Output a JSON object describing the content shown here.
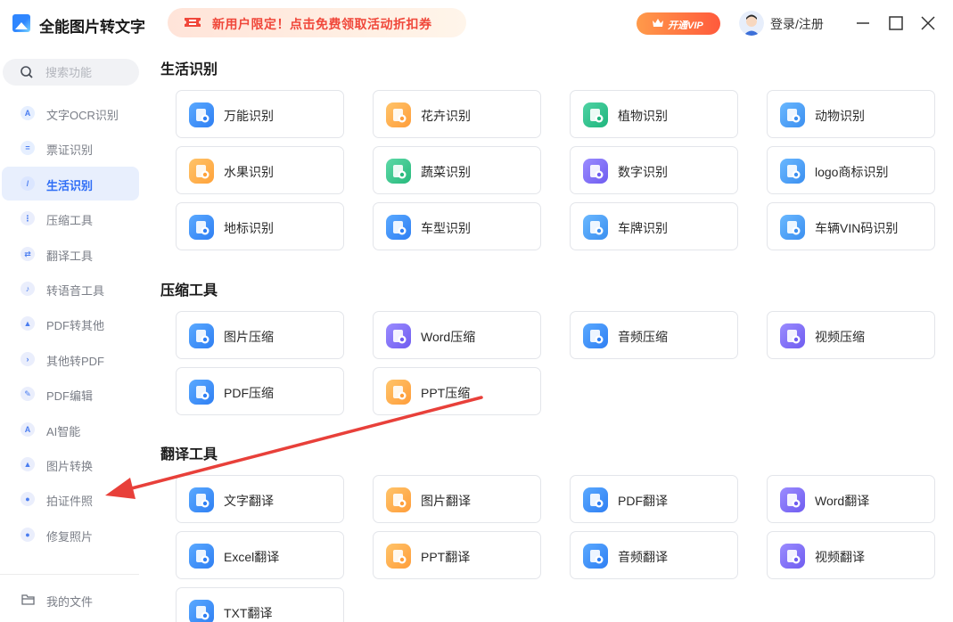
{
  "app": {
    "title": "全能图片转文字"
  },
  "promo": {
    "text": "新用户限定！点击免费领取活动折扣券"
  },
  "header": {
    "vip_label": "开通VIP",
    "login_label": "登录/注册"
  },
  "colors": {
    "accent": "#2f6ef6",
    "promo_text": "#f0473a",
    "vip_start": "#ff9a4a",
    "vip_end": "#ff5a3c",
    "arrow": "#e8403a"
  },
  "sidebar": {
    "search_placeholder": "搜索功能",
    "items": [
      {
        "label": "文字OCR识别",
        "icon": "ocr-icon",
        "active": false
      },
      {
        "label": "票证识别",
        "icon": "ticket-icon",
        "active": false
      },
      {
        "label": "生活识别",
        "icon": "life-icon",
        "active": true
      },
      {
        "label": "压缩工具",
        "icon": "compress-icon",
        "active": false
      },
      {
        "label": "翻译工具",
        "icon": "translate-icon",
        "active": false
      },
      {
        "label": "转语音工具",
        "icon": "voice-icon",
        "active": false
      },
      {
        "label": "PDF转其他",
        "icon": "pdf-to-icon",
        "active": false
      },
      {
        "label": "其他转PDF",
        "icon": "to-pdf-icon",
        "active": false
      },
      {
        "label": "PDF编辑",
        "icon": "pdf-edit-icon",
        "active": false
      },
      {
        "label": "AI智能",
        "icon": "ai-icon",
        "active": false
      },
      {
        "label": "图片转换",
        "icon": "image-convert-icon",
        "active": false
      },
      {
        "label": "拍证件照",
        "icon": "id-photo-icon",
        "active": false
      },
      {
        "label": "修复照片",
        "icon": "photo-repair-icon",
        "active": false
      }
    ],
    "my_files_label": "我的文件"
  },
  "sections": [
    {
      "title": "生活识别",
      "items": [
        {
          "label": "万能识别",
          "icon": "universal-recognize-icon"
        },
        {
          "label": "花卉识别",
          "icon": "flower-recognize-icon"
        },
        {
          "label": "植物识别",
          "icon": "plant-recognize-icon"
        },
        {
          "label": "动物识别",
          "icon": "animal-recognize-icon"
        },
        {
          "label": "水果识别",
          "icon": "fruit-recognize-icon"
        },
        {
          "label": "蔬菜识别",
          "icon": "vegetable-recognize-icon"
        },
        {
          "label": "数字识别",
          "icon": "number-recognize-icon"
        },
        {
          "label": "logo商标识别",
          "icon": "logo-recognize-icon"
        },
        {
          "label": "地标识别",
          "icon": "landmark-recognize-icon"
        },
        {
          "label": "车型识别",
          "icon": "car-model-recognize-icon"
        },
        {
          "label": "车牌识别",
          "icon": "license-plate-recognize-icon"
        },
        {
          "label": "车辆VIN码识别",
          "icon": "vin-recognize-icon"
        }
      ]
    },
    {
      "title": "压缩工具",
      "items": [
        {
          "label": "图片压缩",
          "icon": "image-compress-icon"
        },
        {
          "label": "Word压缩",
          "icon": "word-compress-icon"
        },
        {
          "label": "音频压缩",
          "icon": "audio-compress-icon"
        },
        {
          "label": "视频压缩",
          "icon": "video-compress-icon"
        },
        {
          "label": "PDF压缩",
          "icon": "pdf-compress-icon"
        },
        {
          "label": "PPT压缩",
          "icon": "ppt-compress-icon"
        }
      ]
    },
    {
      "title": "翻译工具",
      "items": [
        {
          "label": "文字翻译",
          "icon": "text-translate-icon"
        },
        {
          "label": "图片翻译",
          "icon": "image-translate-icon"
        },
        {
          "label": "PDF翻译",
          "icon": "pdf-translate-icon"
        },
        {
          "label": "Word翻译",
          "icon": "word-translate-icon"
        },
        {
          "label": "Excel翻译",
          "icon": "excel-translate-icon"
        },
        {
          "label": "PPT翻译",
          "icon": "ppt-translate-icon"
        },
        {
          "label": "音频翻译",
          "icon": "audio-translate-icon"
        },
        {
          "label": "视频翻译",
          "icon": "video-translate-icon"
        },
        {
          "label": "TXT翻译",
          "icon": "txt-translate-icon"
        }
      ]
    }
  ]
}
